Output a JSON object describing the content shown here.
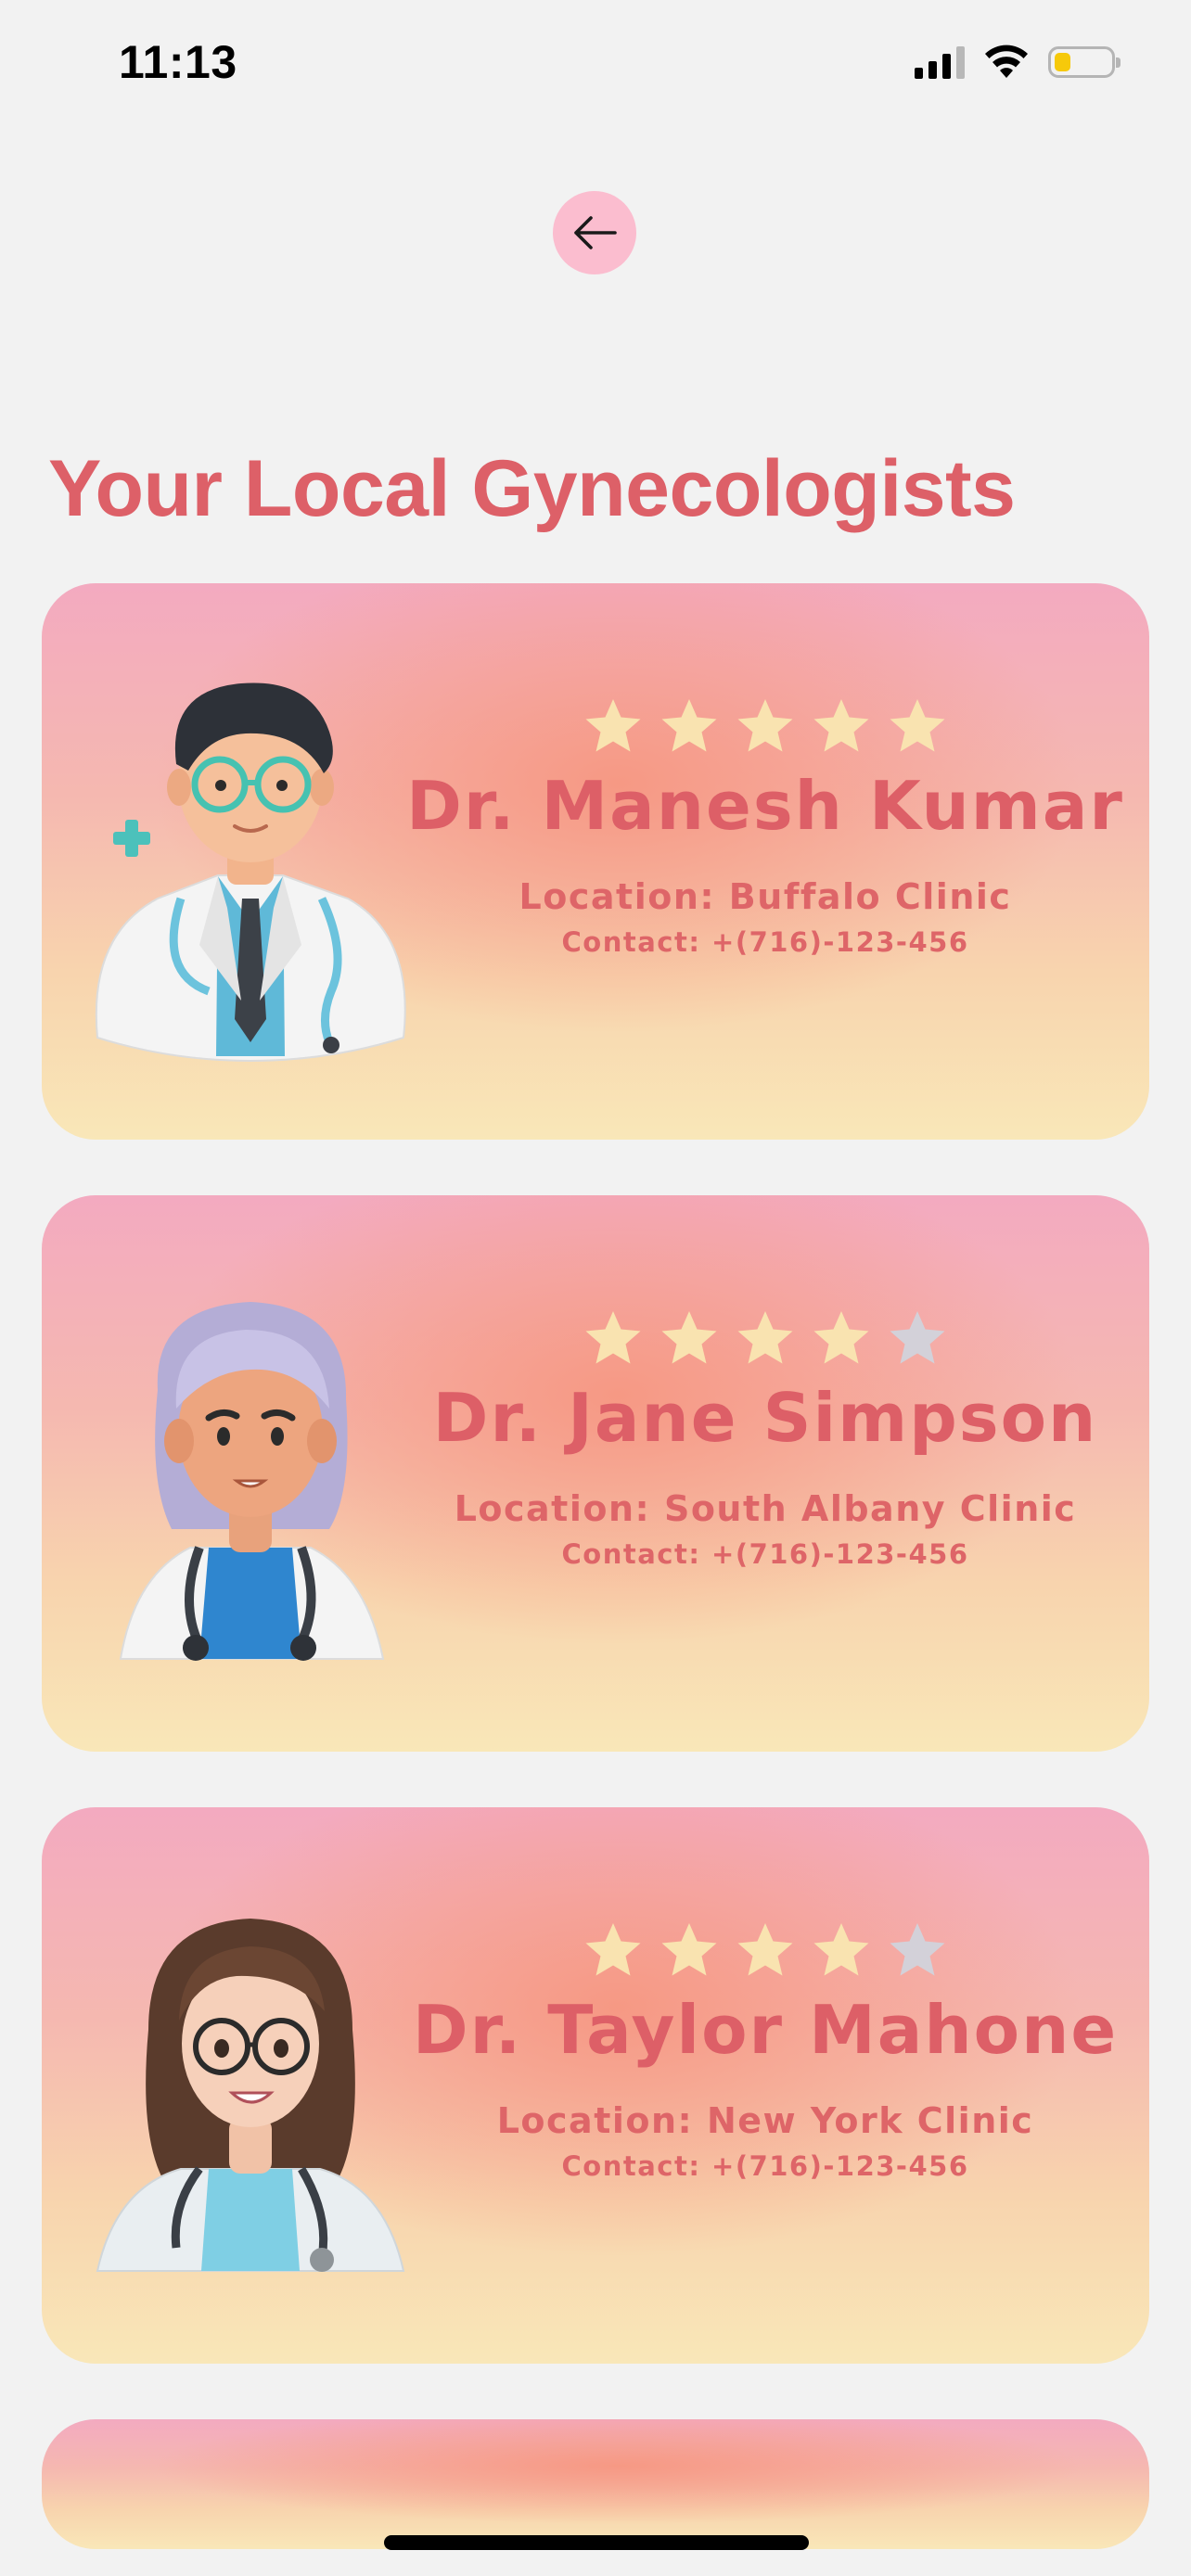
{
  "status_bar": {
    "time": "11:13",
    "battery_level": 0.3,
    "battery_color": "#f6c90a"
  },
  "navigation": {
    "back_icon": "arrow-left-icon",
    "back_button_color": "#fbbdcf"
  },
  "page": {
    "title": "Your Local Gynecologists",
    "accent_color": "#dd6068"
  },
  "rating": {
    "max_stars": 5,
    "filled_star_color": "#f9e3b0",
    "empty_star_color": "#d3d1d9"
  },
  "doctors": [
    {
      "name": "Dr. Manesh Kumar",
      "rating": 5,
      "location": "Location: Buffalo Clinic",
      "contact": "Contact: +(716)-123-456",
      "avatar": "male-doctor-avatar"
    },
    {
      "name": "Dr. Jane Simpson",
      "rating": 4,
      "location": "Location: South Albany Clinic",
      "contact": "Contact: +(716)-123-456",
      "avatar": "lavender-hair-doctor-avatar"
    },
    {
      "name": "Dr. Taylor Mahone",
      "rating": 4,
      "location": "Location: New York Clinic",
      "contact": "Contact: +(716)-123-456",
      "avatar": "female-doctor-avatar"
    }
  ]
}
